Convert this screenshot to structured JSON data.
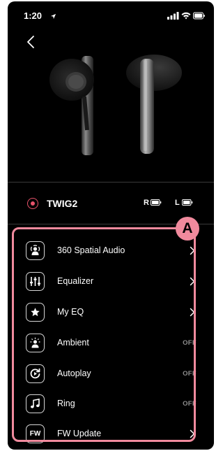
{
  "status_bar": {
    "time": "1:20",
    "location_icon": "location-arrow-icon",
    "signal_icon": "cellular-signal-icon",
    "wifi_icon": "wifi-icon",
    "battery_icon": "battery-icon"
  },
  "header": {
    "back_icon": "chevron-left-icon"
  },
  "device": {
    "name": "TWIG2",
    "status_color": "#e8536b",
    "right_label": "R",
    "left_label": "L"
  },
  "annotation": {
    "badge_label": "A",
    "color": "#f08a9d"
  },
  "menu": [
    {
      "label": "360 Spatial Audio",
      "icon": "spatial-audio-icon",
      "trailing": "chevron"
    },
    {
      "label": "Equalizer",
      "icon": "equalizer-sliders-icon",
      "trailing": "chevron"
    },
    {
      "label": "My EQ",
      "icon": "star-icon",
      "trailing": "chevron"
    },
    {
      "label": "Ambient",
      "icon": "ambient-icon",
      "trailing": "OFF"
    },
    {
      "label": "Autoplay",
      "icon": "autoplay-icon",
      "trailing": "OFF"
    },
    {
      "label": "Ring",
      "icon": "music-note-icon",
      "trailing": "OFF"
    },
    {
      "label": "FW Update",
      "icon": "fw-update-icon",
      "icon_text": "FW",
      "trailing": "chevron"
    }
  ]
}
